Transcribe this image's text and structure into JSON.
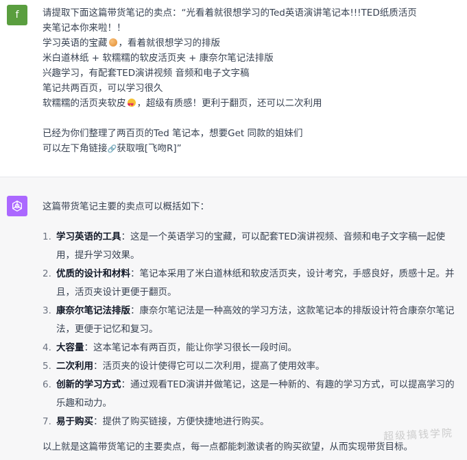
{
  "user": {
    "avatar_letter": "f",
    "lines": [
      "请提取下面这篇带货笔记的卖点：“光看着就很想学习的Ted英语演讲笔记本!!!TED纸质活页",
      "夹笔记本你来啦！！",
      "学习英语的宝藏",
      "，看着就很想学习的排版",
      "米白道林纸 + 软糯糯的软皮活页夹 + 康奈尔笔记法排版",
      "兴趣学习，有配套TED演讲视频 音频和电子文字稿",
      "笔记共两百页，可以学习很久",
      "软糯糯的活页夹软皮",
      "，超级有质感！更利于翻页，还可以二次利用",
      "已经为你们整理了两百页的Ted 笔记本，想要Get 同款的姐妹们",
      "可以左下角链接",
      "获取哦[飞吻R]”"
    ]
  },
  "assistant": {
    "intro": "这篇带货笔记主要的卖点可以概括如下：",
    "items": [
      {
        "num": "1.",
        "title": "学习英语的工具",
        "sep": "：",
        "text": "这是一个英语学习的宝藏，可以配套TED演讲视频、音频和电子文字稿一起使用，提升学习效果。"
      },
      {
        "num": "2.",
        "title": "优质的设计和材料",
        "sep": "：",
        "text": "笔记本采用了米白道林纸和软皮活页夹，设计考究，手感良好，质感十足。并且，活页夹设计更便于翻页。"
      },
      {
        "num": "3.",
        "title": "康奈尔笔记法排版",
        "sep": "：",
        "text": "康奈尔笔记法是一种高效的学习方法，这款笔记本的排版设计符合康奈尔笔记法，更便于记忆和复习。"
      },
      {
        "num": "4.",
        "title": "大容量",
        "sep": "：",
        "text": "这本笔记本有两百页，能让你学习很长一段时间。"
      },
      {
        "num": "5.",
        "title": "二次利用",
        "sep": "：",
        "text": "活页夹的设计使得它可以二次利用，提高了使用效率。"
      },
      {
        "num": "6.",
        "title": "创新的学习方式",
        "sep": "：",
        "text": "通过观看TED演讲并做笔记，这是一种新的、有趣的学习方式，可以提高学习的乐趣和动力。"
      },
      {
        "num": "7.",
        "title": "易于购买",
        "sep": "：",
        "text": "提供了购买链接，方便快捷地进行购买。"
      }
    ],
    "outro": "以上就是这篇带货笔记的主要卖点，每一点都能刺激读者的购买欲望，从而实现带货目标。"
  },
  "watermark": "超级搞钱学院",
  "colors": {
    "user_avatar": "#5a9e3f",
    "assistant_avatar": "#ab68ff",
    "assistant_bg": "#f7f7f8"
  },
  "icons": [
    "openai-logo-icon",
    "cookie-emoji-icon",
    "heart-eyes-emoji-icon",
    "link-icon"
  ]
}
